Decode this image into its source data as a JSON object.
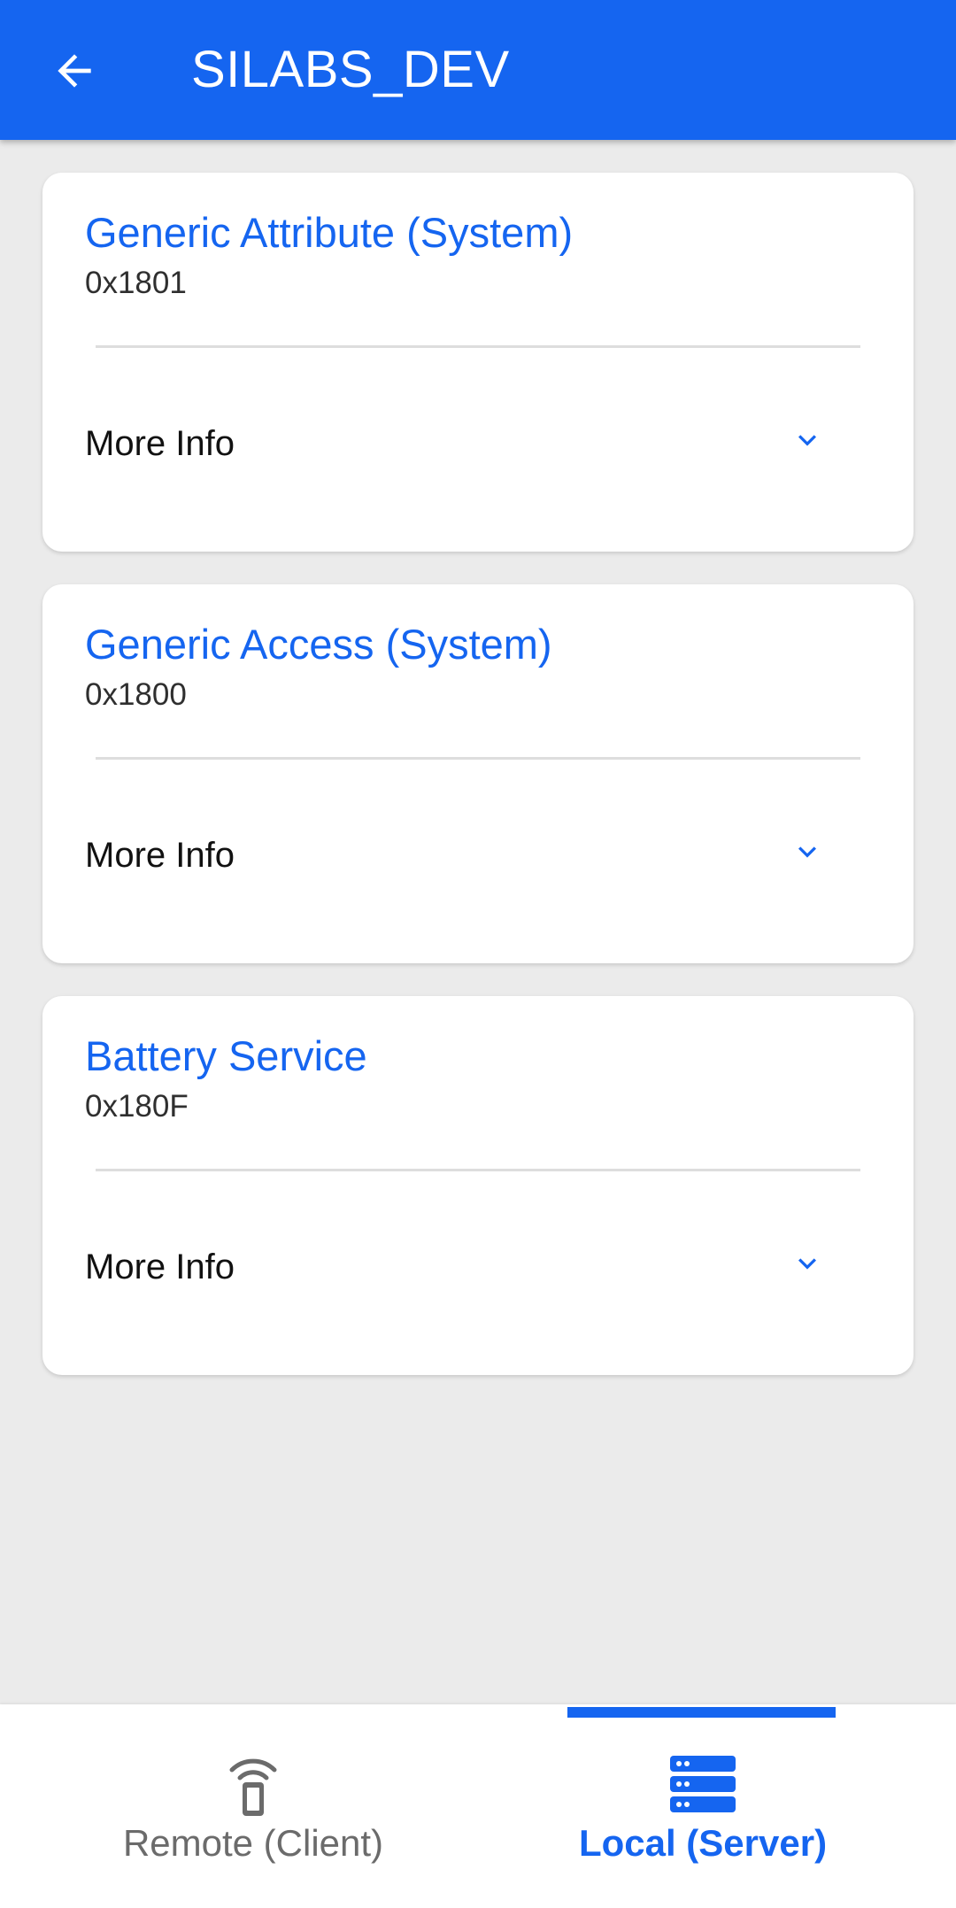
{
  "header": {
    "title": "SILABS_DEV",
    "back_icon": "arrow-back-icon",
    "background": "#1565f0"
  },
  "services": [
    {
      "name": "Generic Attribute (System)",
      "uuid": "0x1801",
      "more_info": "More Info",
      "expand_icon": "chevron-down-icon"
    },
    {
      "name": "Generic Access (System)",
      "uuid": "0x1800",
      "more_info": "More Info",
      "expand_icon": "chevron-down-icon"
    },
    {
      "name": "Battery Service",
      "uuid": "0x180F",
      "more_info": "More Info",
      "expand_icon": "chevron-down-icon"
    }
  ],
  "bottom_nav": {
    "tabs": [
      {
        "label": "Remote (Client)",
        "icon": "remote-device-icon",
        "selected": false
      },
      {
        "label": "Local (Server)",
        "icon": "server-icon",
        "selected": true
      }
    ],
    "active_color": "#1565f0",
    "inactive_color": "#6b6b6b"
  }
}
